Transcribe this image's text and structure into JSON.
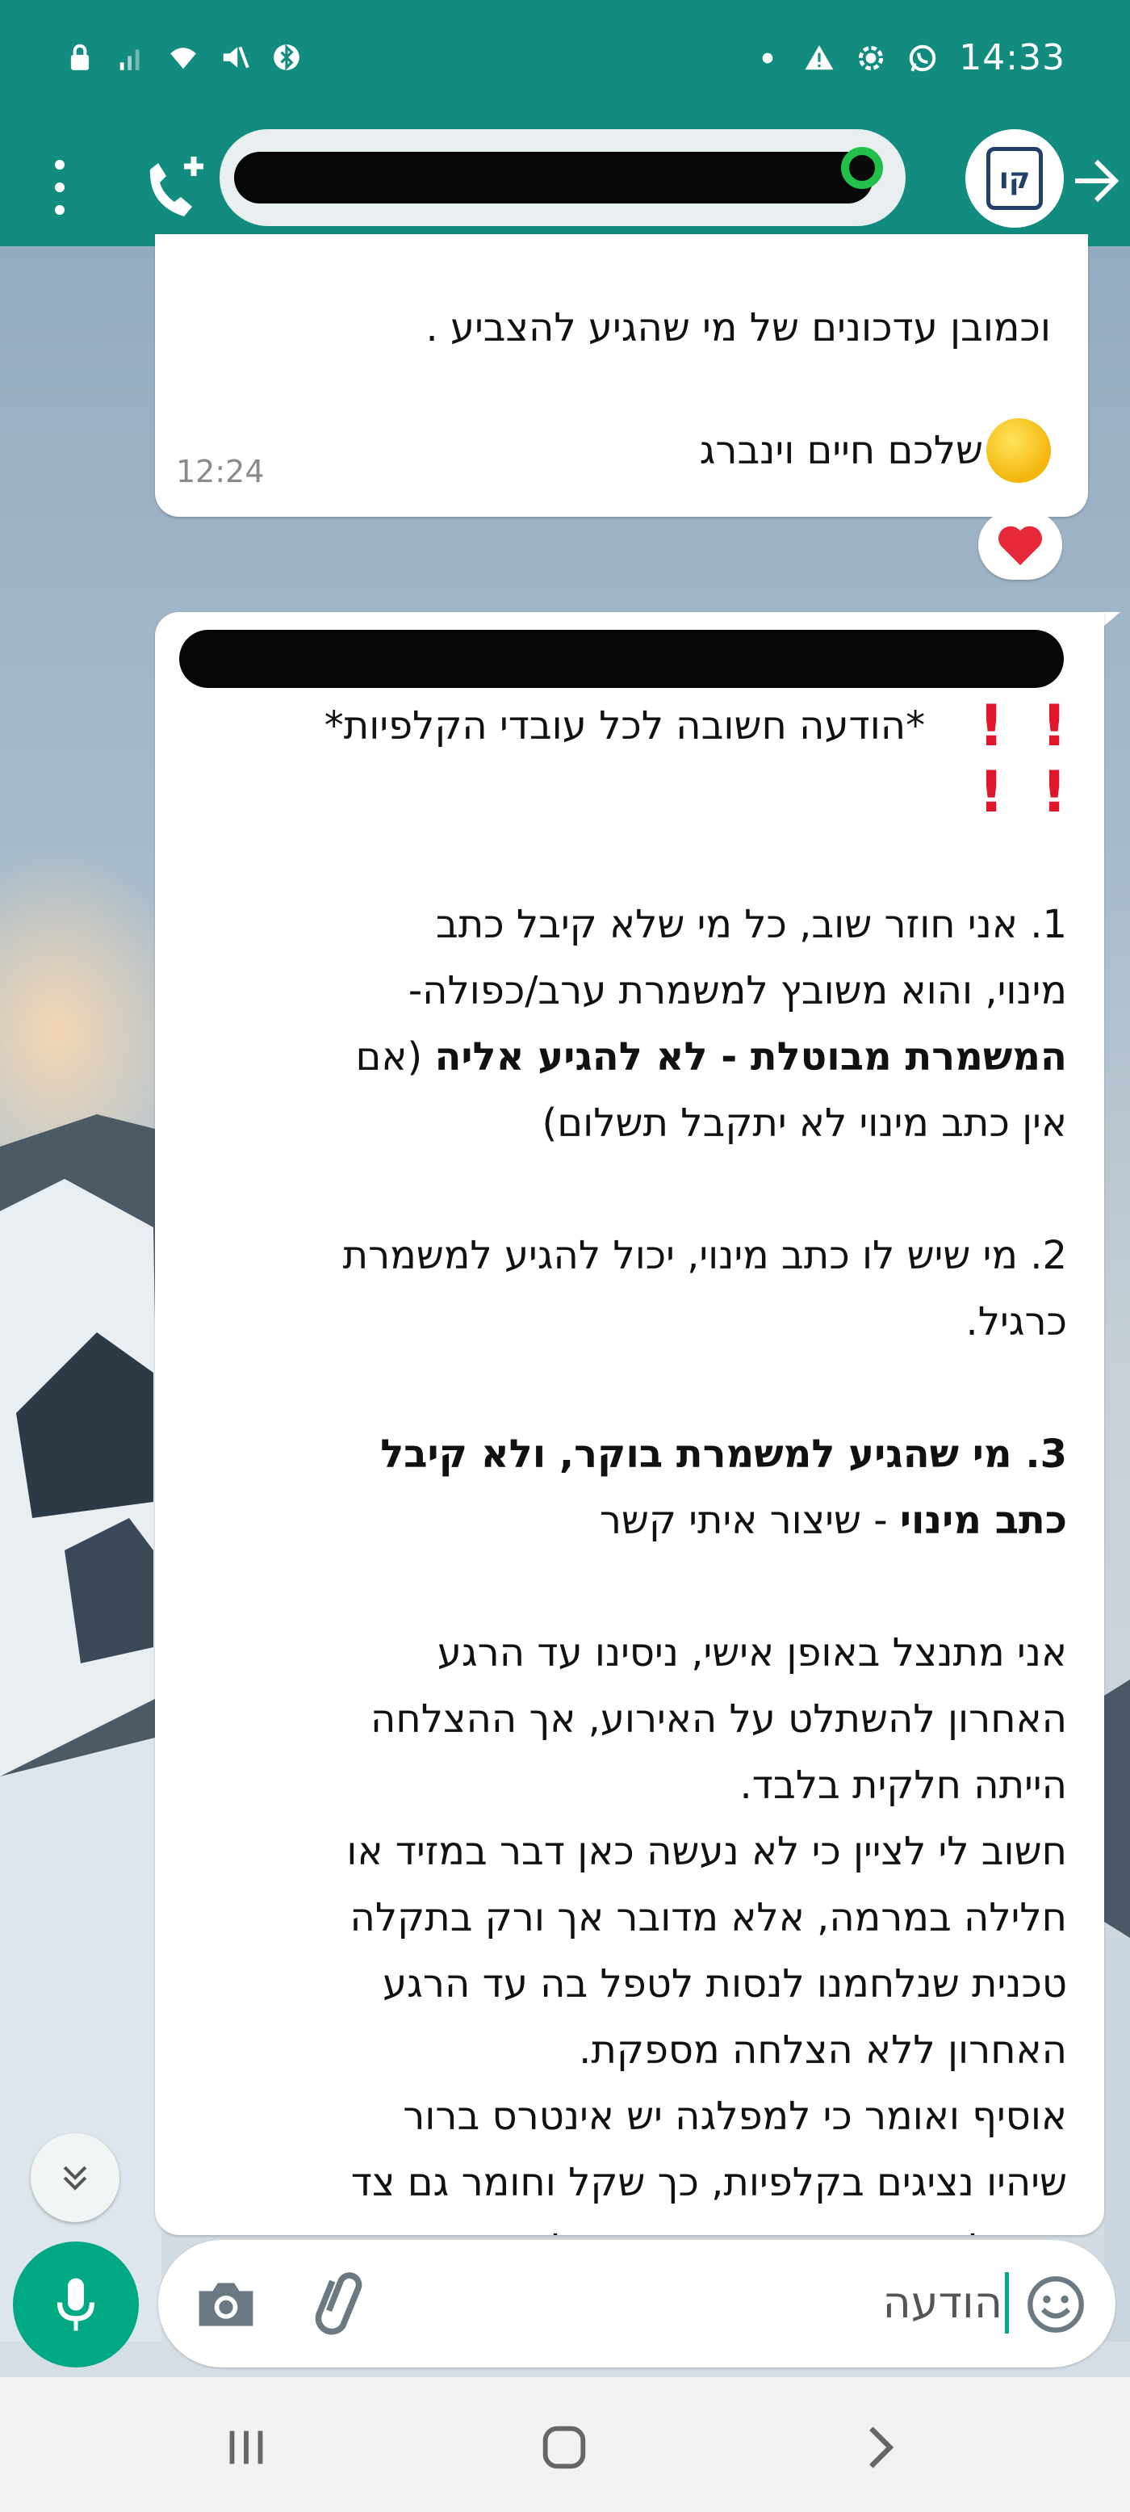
{
  "status_bar": {
    "time": "14:33"
  },
  "header": {
    "contact_name": "",
    "avatar_text": "קו"
  },
  "messages": [
    {
      "lines": [
        "וכמובן עדכונים של מי שהגיע להצביע .",
        "שלכם חיים וינברג"
      ],
      "time": "12:24",
      "reaction": "heart"
    },
    {
      "headline": "*הודעה חשובה לכל עובדי הקלפיות*",
      "body": [
        "1. אני חוזר שוב, כל מי שלא קיבל כתב",
        "מינוי, והוא משובץ למשמרת ערב/כפולה-",
        "המשמרת מבוטלת - לא להגיע אליה",
        "(אם",
        "אין כתב מינוי לא יתקבל תשלום)",
        "2. מי שיש לו כתב מינוי, יכול להגיע למשמרת",
        "כרגיל.",
        "3. מי שהגיע למשמרת בוקר, ולא קיבל",
        "כתב מינוי",
        " - שיצור איתי קשר",
        "אני מתנצל באופן אישי, ניסינו עד הרגע",
        "האחרון להשתלט על האירוע, אך ההצלחה",
        "הייתה חלקית בלבד.",
        "חשוב לי לציין כי לא נעשה כאן דבר במזיד או",
        "חלילה במרמה, אלא מדובר אך ורק בתקלה",
        "טכנית שנלחמנו לנסות לטפל בה עד הרגע",
        "האחרון ללא הצלחה מספקת.",
        "אוסיף ואומר כי למפלגה יש אינטרס ברור",
        "שיהיו נציגים בקלפיות, כך שקל וחומר גם צד",
        "המפלגה נפגע בתוצאה מהתקלה."
      ]
    }
  ],
  "input": {
    "text": "הודעה"
  },
  "colors": {
    "header_bg": "#128c7e",
    "mic_bg": "#00a884",
    "exclamation": "#e0162b"
  },
  "icons": {
    "status_left": [
      "lock-icon",
      "signal-icon",
      "wifi-icon",
      "mute-icon",
      "bluetooth-icon"
    ],
    "status_right": [
      "dot-icon",
      "warning-icon",
      "settings-icon",
      "whatsapp-icon"
    ],
    "header": [
      "menu-icon",
      "add-call-icon",
      "back-arrow-icon"
    ],
    "input": [
      "camera-icon",
      "attach-icon",
      "emoji-icon",
      "mic-icon"
    ]
  }
}
